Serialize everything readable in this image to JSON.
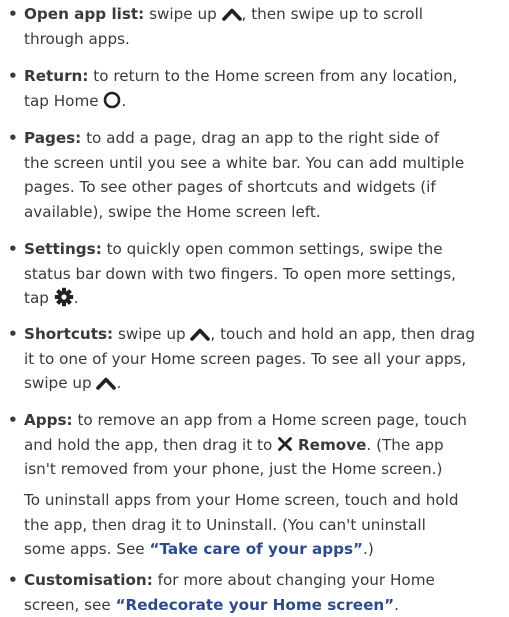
{
  "items": [
    {
      "term": "Open app list:",
      "a": " swipe up ",
      "b": ", then swipe up to scroll\nthrough apps."
    },
    {
      "term": "Return:",
      "a": " to return to the Home screen from any location,\ntap Home ",
      "b": "."
    },
    {
      "term": "Pages:",
      "a": " to add a page, drag an app to the right side of\nthe screen until you see a white bar. You can add multiple\npages. To see other pages of shortcuts and widgets (if\navailable), swipe the Home screen left."
    },
    {
      "term": "Settings:",
      "a": " to quickly open common settings, swipe the\nstatus bar down with two fingers. To open more settings,\ntap ",
      "b": "."
    },
    {
      "term": "Shortcuts:",
      "a": " swipe up ",
      "b": ", touch and hold an app, then drag\nit to one of your Home screen pages. To see all your apps,\nswipe up ",
      "c": "."
    },
    {
      "term": "Apps:",
      "a": " to remove an app from a Home screen page, touch\nand hold the app, then drag it to ",
      "remove": "Remove",
      "b": ". (The app\nisn't removed from your phone, just the Home screen.)"
    },
    {
      "term": "Customisation:",
      "a": " for more about changing your Home\nscreen, see ",
      "link": "“Redecorate your Home screen”",
      "b": "."
    }
  ],
  "note": {
    "a": "To uninstall apps from your Home screen, touch and hold\nthe app, then drag it to Uninstall. (You can't uninstall\nsome apps. See ",
    "link": "“Take care of your apps”",
    "b": ".)"
  },
  "icons": {
    "swipe_up": "chevron-up-icon",
    "home": "home-circle-icon",
    "settings": "gear-icon",
    "remove": "close-x-icon"
  }
}
